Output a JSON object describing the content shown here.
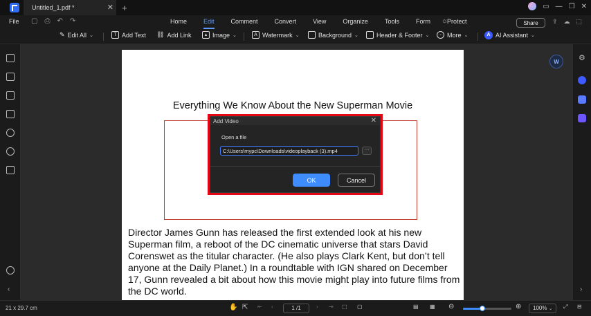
{
  "titlebar": {
    "tab_title": "Untitled_1.pdf *",
    "tab_close": "✕",
    "new_tab": "+",
    "window_controls": [
      "⎘",
      "—",
      "❐",
      "✕"
    ]
  },
  "menubar": {
    "file": "File",
    "quick_icons": [
      "save-icon",
      "print-icon",
      "undo-icon",
      "redo-icon"
    ],
    "tabs": [
      "Home",
      "Edit",
      "Comment",
      "Convert",
      "View",
      "Organize",
      "Tools",
      "Form",
      "Protect"
    ],
    "active_tab": "Edit",
    "share": "Share"
  },
  "toolbar": {
    "edit_all": "Edit All",
    "add_text": "Add Text",
    "add_link": "Add Link",
    "image": "Image",
    "watermark": "Watermark",
    "background": "Background",
    "header_footer": "Header & Footer",
    "more": "More",
    "ai_assistant": "AI Assistant"
  },
  "document": {
    "title": "Everything We Know About the New Superman Movie",
    "body": "Director James Gunn has released the first extended look at his new Superman film, a reboot of the DC cinematic universe that stars David Corenswet as the titular character. (He also plays Clark Kent, but don’t tell anyone at the Daily Planet.) In a roundtable with IGN shared on December 17, Gunn revealed a bit about how this movie might play into future films from the DC world."
  },
  "dialog": {
    "title": "Add Video",
    "close": "✕",
    "open_label": "Open a file",
    "path_value": "C:\\Users\\mypc\\Downloads\\videoplayback (3).mp4",
    "browse": "···",
    "ok": "OK",
    "cancel": "Cancel"
  },
  "statusbar": {
    "page_size": "21 x 29.7 cm",
    "page_indicator": "1 /1",
    "zoom": "100%",
    "zoom_level": 0.4
  },
  "colors": {
    "accent": "#3f8cff",
    "highlight": "#e30613"
  }
}
